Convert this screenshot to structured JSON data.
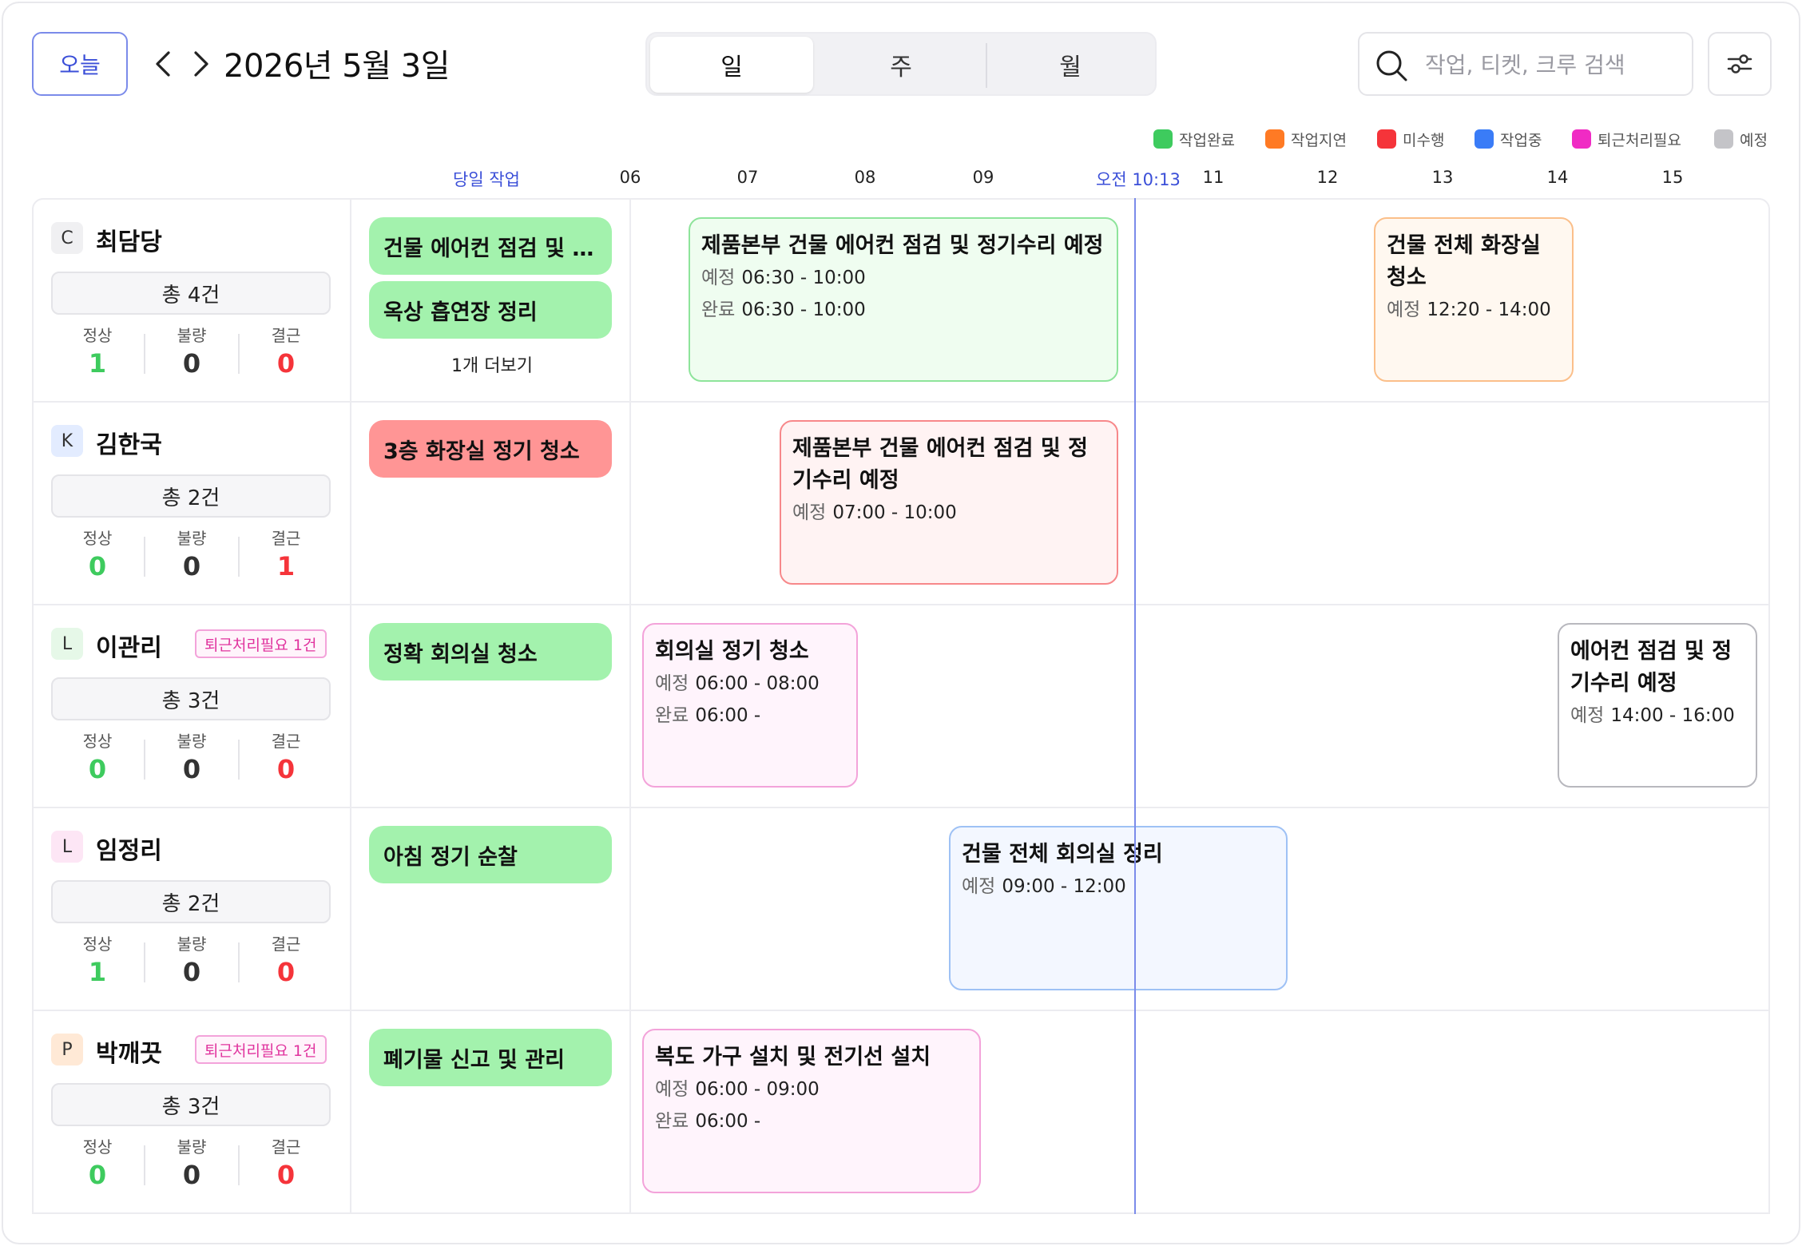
{
  "toolbar": {
    "today_label": "오늘",
    "date_title": "2026년 5월 3일",
    "views": [
      "일",
      "주",
      "월"
    ],
    "active_view": "일",
    "search_placeholder": "작업, 티켓, 크루 검색",
    "search_value": ""
  },
  "legend": [
    {
      "label": "작업완료",
      "color": "#3ecb5e"
    },
    {
      "label": "작업지연",
      "color": "#ff7a24"
    },
    {
      "label": "미수행",
      "color": "#f5343a"
    },
    {
      "label": "작업중",
      "color": "#3a7cf7"
    },
    {
      "label": "퇴근처리필요",
      "color": "#f02bc4"
    },
    {
      "label": "예정",
      "color": "#c4c4c8"
    }
  ],
  "timeline": {
    "daily_header": "당일 작업",
    "hours": [
      "06",
      "07",
      "08",
      "09",
      "11",
      "12",
      "13",
      "14",
      "15"
    ],
    "now_label": "오전 10:13"
  },
  "stat_labels": {
    "normal": "정상",
    "defect": "불량",
    "absent": "결근"
  },
  "crews": [
    {
      "initial": "C",
      "name": "최담당",
      "total": "총 4건",
      "stats": {
        "normal": "1",
        "defect": "0",
        "absent": "0"
      },
      "badge": "",
      "daily": [
        "건물 에어컨 점검 및 정...",
        "옥상 흡연장 정리"
      ],
      "more": "1개 더보기",
      "cards": [
        {
          "title": "제품본부 건물 에어컨 점검 및 정기수리 예정",
          "rows": [
            {
              "k": "예정",
              "v": "06:30 - 10:00"
            },
            {
              "k": "완료",
              "v": "06:30 - 10:00"
            }
          ]
        },
        {
          "title": "건물 전체 화장실 청소",
          "rows": [
            {
              "k": "예정",
              "v": "12:20 - 14:00"
            }
          ]
        }
      ]
    },
    {
      "initial": "K",
      "name": "김한국",
      "total": "총 2건",
      "stats": {
        "normal": "0",
        "defect": "0",
        "absent": "1"
      },
      "badge": "",
      "daily": [
        "3층 화장실 정기 청소"
      ],
      "cards": [
        {
          "title": "제품본부 건물 에어컨 점검 및 정기수리 예정",
          "rows": [
            {
              "k": "예정",
              "v": "07:00 - 10:00"
            }
          ]
        }
      ]
    },
    {
      "initial": "L",
      "name": "이관리",
      "total": "총 3건",
      "stats": {
        "normal": "0",
        "defect": "0",
        "absent": "0"
      },
      "badge": "퇴근처리필요 1건",
      "daily": [
        "정확 회의실 청소"
      ],
      "cards": [
        {
          "title": "회의실 정기 청소",
          "rows": [
            {
              "k": "예정",
              "v": "06:00 - 08:00"
            },
            {
              "k": "완료",
              "v": "06:00 -"
            }
          ]
        },
        {
          "title": "에어컨 점검 및 정기수리 예정",
          "rows": [
            {
              "k": "예정",
              "v": "14:00 - 16:00"
            }
          ]
        }
      ]
    },
    {
      "initial": "L",
      "name": "임정리",
      "total": "총 2건",
      "stats": {
        "normal": "1",
        "defect": "0",
        "absent": "0"
      },
      "badge": "",
      "daily": [
        "아침 정기 순찰"
      ],
      "cards": [
        {
          "title": "건물 전체 회의실 정리",
          "rows": [
            {
              "k": "예정",
              "v": "09:00 - 12:00"
            }
          ]
        }
      ]
    },
    {
      "initial": "P",
      "name": "박깨끗",
      "total": "총 3건",
      "stats": {
        "normal": "0",
        "defect": "0",
        "absent": "0"
      },
      "badge": "퇴근처리필요 1건",
      "daily": [
        "폐기물 신고 및 관리"
      ],
      "cards": [
        {
          "title": "복도 가구 설치 및 전기선 설치",
          "rows": [
            {
              "k": "예정",
              "v": "06:00 - 09:00"
            },
            {
              "k": "완료",
              "v": "06:00 -"
            }
          ]
        }
      ]
    }
  ]
}
